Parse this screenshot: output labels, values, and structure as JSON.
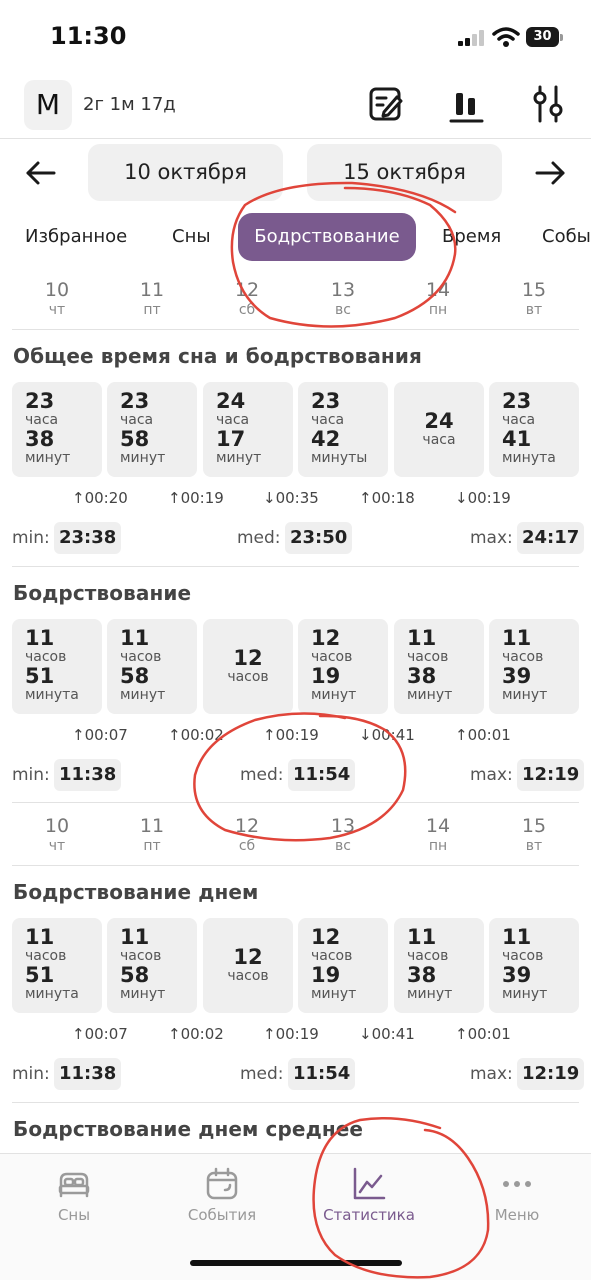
{
  "status": {
    "time": "11:30",
    "battery": "30"
  },
  "header": {
    "avatar": "M",
    "age": "2г 1м 17д",
    "icons": [
      "edit-icon",
      "bar-chart-icon",
      "settings-sliders-icon"
    ]
  },
  "range": {
    "from": "10 октября",
    "to": "15 октября"
  },
  "tabs": [
    {
      "label": "Избранное"
    },
    {
      "label": "Сны"
    },
    {
      "label": "Бодрствование",
      "active": true
    },
    {
      "label": "Время"
    },
    {
      "label": "Собы"
    }
  ],
  "days": [
    {
      "num": "10",
      "wd": "чт"
    },
    {
      "num": "11",
      "wd": "пт"
    },
    {
      "num": "12",
      "wd": "сб"
    },
    {
      "num": "13",
      "wd": "вс"
    },
    {
      "num": "14",
      "wd": "пн"
    },
    {
      "num": "15",
      "wd": "вт"
    }
  ],
  "sections": [
    {
      "title": "Общее время сна и бодрствования",
      "cards": [
        {
          "h": "23",
          "hl": "часа",
          "m": "38",
          "ml": "минут"
        },
        {
          "h": "23",
          "hl": "часа",
          "m": "58",
          "ml": "минут"
        },
        {
          "h": "24",
          "hl": "часа",
          "m": "17",
          "ml": "минут"
        },
        {
          "h": "23",
          "hl": "часа",
          "m": "42",
          "ml": "минуты"
        },
        {
          "h": "24",
          "hl": "часа",
          "m": "",
          "ml": ""
        },
        {
          "h": "23",
          "hl": "часа",
          "m": "41",
          "ml": "минута"
        }
      ],
      "deltas": [
        "↑00:20",
        "↑00:19",
        "↓00:35",
        "↑00:18",
        "↓00:19"
      ],
      "min_label": "min:",
      "min": "23:38",
      "med_label": "med:",
      "med": "23:50",
      "max_label": "max:",
      "max": "24:17"
    },
    {
      "title": "Бодрствование",
      "cards": [
        {
          "h": "11",
          "hl": "часов",
          "m": "51",
          "ml": "минута"
        },
        {
          "h": "11",
          "hl": "часов",
          "m": "58",
          "ml": "минут"
        },
        {
          "h": "12",
          "hl": "часов",
          "m": "",
          "ml": ""
        },
        {
          "h": "12",
          "hl": "часов",
          "m": "19",
          "ml": "минут"
        },
        {
          "h": "11",
          "hl": "часов",
          "m": "38",
          "ml": "минут"
        },
        {
          "h": "11",
          "hl": "часов",
          "m": "39",
          "ml": "минут"
        }
      ],
      "deltas": [
        "↑00:07",
        "↑00:02",
        "↑00:19",
        "↓00:41",
        "↑00:01"
      ],
      "min_label": "min:",
      "min": "11:38",
      "med_label": "med:",
      "med": "11:54",
      "max_label": "max:",
      "max": "12:19"
    },
    {
      "title": "Бодрствование днем",
      "cards": [
        {
          "h": "11",
          "hl": "часов",
          "m": "51",
          "ml": "минута"
        },
        {
          "h": "11",
          "hl": "часов",
          "m": "58",
          "ml": "минут"
        },
        {
          "h": "12",
          "hl": "часов",
          "m": "",
          "ml": ""
        },
        {
          "h": "12",
          "hl": "часов",
          "m": "19",
          "ml": "минут"
        },
        {
          "h": "11",
          "hl": "часов",
          "m": "38",
          "ml": "минут"
        },
        {
          "h": "11",
          "hl": "часов",
          "m": "39",
          "ml": "минут"
        }
      ],
      "deltas": [
        "↑00:07",
        "↑00:02",
        "↑00:19",
        "↓00:41",
        "↑00:01"
      ],
      "min_label": "min:",
      "min": "11:38",
      "med_label": "med:",
      "med": "11:54",
      "max_label": "max:",
      "max": "12:19"
    }
  ],
  "next_section_title": "Бодрствование днем среднее",
  "tabbar": [
    {
      "label": "Сны",
      "icon": "bed-icon"
    },
    {
      "label": "События",
      "icon": "calendar-icon"
    },
    {
      "label": "Статистика",
      "icon": "chart-icon",
      "active": true
    },
    {
      "label": "Меню",
      "icon": "more-icon"
    }
  ],
  "colors": {
    "accent": "#7a5a8e",
    "annotation": "#e0453a",
    "card": "#efefef"
  }
}
